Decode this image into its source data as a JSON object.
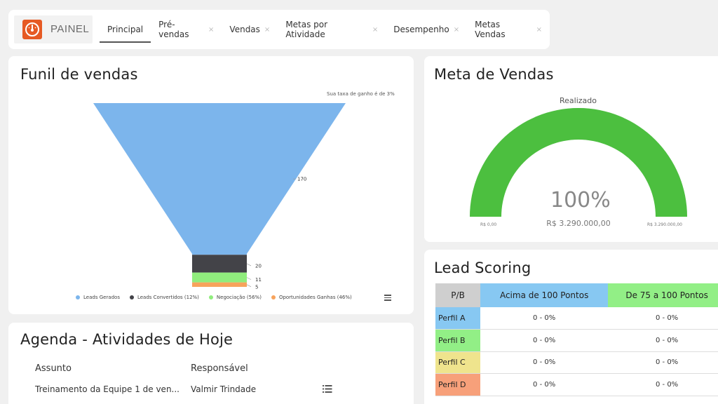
{
  "logo": {
    "text": "PAINEL"
  },
  "tabs": [
    {
      "label": "Principal",
      "active": true
    },
    {
      "label": "Pré-vendas",
      "close": "×"
    },
    {
      "label": "Vendas",
      "close": "×"
    },
    {
      "label": "Metas por Atividade",
      "close": "×"
    },
    {
      "label": "Desempenho",
      "close": "×"
    },
    {
      "label": "Metas Vendas",
      "close": "×"
    }
  ],
  "funnel": {
    "title": "Funil de vendas",
    "subtitle": "Sua taxa de ganho é de 3%",
    "legend_icon": "hamburger-menu-icon"
  },
  "chart_data": {
    "type": "funnel",
    "categories": [
      "Leads Gerados",
      "Leads Convertidos (12%)",
      "Negociação (56%)",
      "Oportunidades Ganhas (46%)"
    ],
    "values": [
      170,
      20,
      11,
      5
    ],
    "colors": [
      "#7cb5ec",
      "#434348",
      "#90ed7d",
      "#f7a35c"
    ],
    "data_labels": [
      "170",
      "20",
      "11",
      "5"
    ],
    "legend_position": "bottom"
  },
  "agenda": {
    "title": "Agenda - Atividades de Hoje",
    "col_subject": "Assunto",
    "col_owner": "Responsável",
    "rows": [
      {
        "subject": "Treinamento da Equipe 1 de ven...",
        "owner": "Valmir Trindade",
        "icon": "list-icon"
      }
    ]
  },
  "meta": {
    "title": "Meta de Vendas",
    "label": "Realizado",
    "percent": "100%",
    "value": "R$ 3.290.000,00",
    "min": "R$ 0,00",
    "max": "R$ 3.290.000,00",
    "fill_fraction": 1.0,
    "color": "#4cbf3f"
  },
  "lead_scoring": {
    "title": "Lead Scoring",
    "headers": [
      "P/B",
      "Acima de 100 Pontos",
      "De 75 a 100 Pontos"
    ],
    "header_colors": [
      "#cfcfcf",
      "#87c8f2",
      "#92ef86"
    ],
    "rows": [
      {
        "label": "Perfil A",
        "color": "#87c8f2",
        "values": [
          "0 - 0%",
          "0 - 0%"
        ]
      },
      {
        "label": "Perfil B",
        "color": "#92ef86",
        "values": [
          "0 - 0%",
          "0 - 0%"
        ]
      },
      {
        "label": "Perfil C",
        "color": "#efe48d",
        "values": [
          "0 - 0%",
          "0 - 0%"
        ]
      },
      {
        "label": "Perfil D",
        "color": "#f7a07a",
        "values": [
          "0 - 0%",
          "0 - 0%"
        ]
      }
    ]
  }
}
